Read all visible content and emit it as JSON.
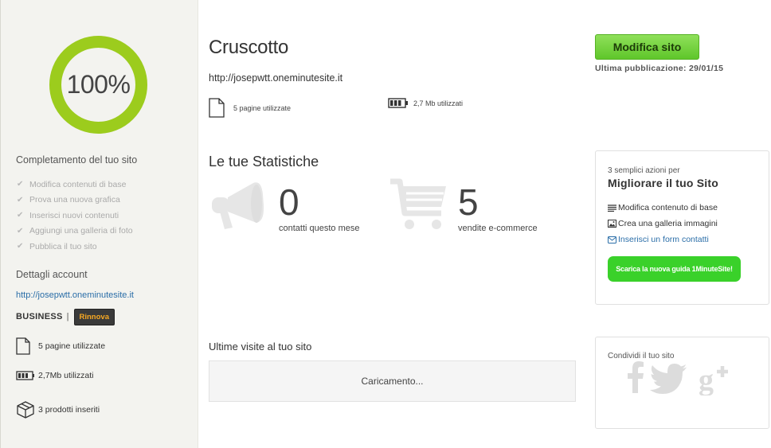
{
  "sidebar": {
    "progress_text": "100%",
    "progress_value": 1.0,
    "completion_heading": "Completamento del tuo sito",
    "checklist": [
      "Modifica contenuti di base",
      "Prova una nuova grafica",
      "Inserisci nuovi contenuti",
      "Aggiungi una galleria di foto",
      "Pubblica il tuo sito"
    ],
    "account_heading": "Dettagli account",
    "account_url": "http://josepwtt.oneminutesite.it",
    "plan_name": "BUSINESS",
    "plan_separator": "|",
    "renew_label": "Rinnova",
    "pages_used": "5 pagine utilizzate",
    "storage_used": "2,7Mb utilizzati",
    "products": "3 prodotti inseriti"
  },
  "main": {
    "title": "Cruscotto",
    "site_url": "http://josepwtt.oneminutesite.it",
    "pages_used": "5 pagine utilizzate",
    "storage_used": "2,7 Mb utilizzati",
    "stats_title": "Le tue Statistiche",
    "contacts_count": "0",
    "contacts_label": "contatti questo mese",
    "sales_count": "5",
    "sales_label": "vendite e-commerce",
    "visits_title": "Ultime visite al tuo sito",
    "loading_text": "Caricamento..."
  },
  "right": {
    "edit_button": "Modifica sito",
    "last_published": "Ultima pubblicazione: 29/01/15",
    "improve_sub": "3 semplici azioni per",
    "improve_title": "Migliorare il tuo Sito",
    "actions": [
      "Modifica contenuto di base",
      "Crea una galleria immagini",
      "Inserisci un form contatti"
    ],
    "guide_button": "Scarica la nuova guida 1MinuteSite!",
    "share_title": "Condividi il tuo sito"
  },
  "colors": {
    "ring": "#9ccc1d",
    "accent_green": "#5fc62a",
    "link_blue": "#2b6ea8",
    "guide_green": "#3ad12a"
  },
  "icons": {
    "checklist": "check-icon",
    "pages": "page-icon",
    "storage": "battery-icon",
    "products": "box-icon",
    "contacts": "megaphone-icon",
    "sales": "cart-icon",
    "social": [
      "facebook-icon",
      "twitter-icon",
      "googleplus-icon"
    ]
  }
}
